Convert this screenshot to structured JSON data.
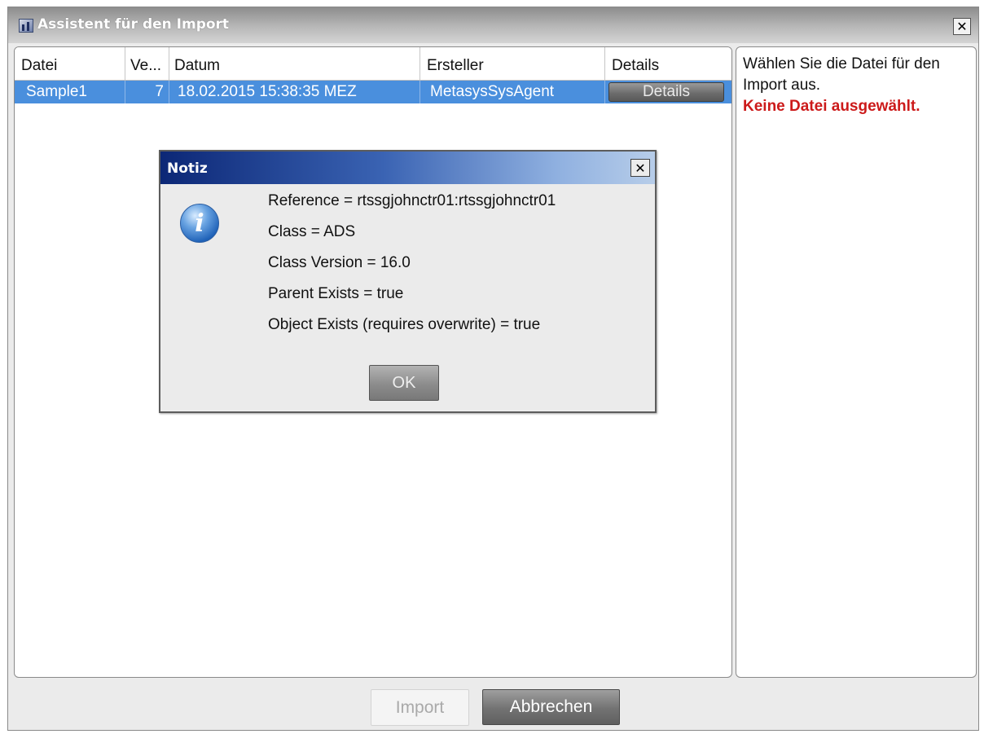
{
  "window": {
    "title": "Assistent für den Import",
    "close_glyph": "✕"
  },
  "table": {
    "columns": [
      "Datei",
      "Ve...",
      "Datum",
      "Ersteller",
      "Details"
    ],
    "rows": [
      {
        "datei": "Sample1",
        "version": "7",
        "datum": "18.02.2015 15:38:35 MEZ",
        "ersteller": "MetasysSysAgent",
        "details_button": "Details"
      }
    ]
  },
  "info_panel": {
    "instruction": "Wählen Sie die Datei für den Import aus.",
    "warning": "Keine Datei ausgewählt.",
    "warning_color": "#cc1a1a"
  },
  "buttons": {
    "import": "Import",
    "import_enabled": false,
    "cancel": "Abbrechen"
  },
  "dialog": {
    "title": "Notiz",
    "close_glyph": "✕",
    "icon": "info-icon",
    "icon_glyph": "i",
    "lines": [
      "Reference = rtssgjohnctr01:rtssgjohnctr01",
      "Class = ADS",
      "Class Version = 16.0",
      "Parent Exists = true",
      "Object Exists (requires overwrite) = true"
    ],
    "ok_button": "OK"
  },
  "colors": {
    "selection": "#4a8fdd",
    "dialog_title_start": "#0c2776",
    "dialog_title_end": "#b7cde9"
  }
}
